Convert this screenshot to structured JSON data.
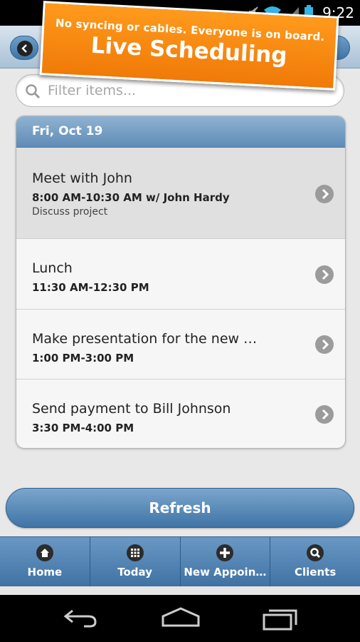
{
  "status_bar": {
    "time": "9:22"
  },
  "promo": {
    "tagline": "No syncing or cables. Everyone is on board.",
    "title": "Live Scheduling"
  },
  "filter": {
    "placeholder": "Filter items..."
  },
  "list": {
    "date_header": "Fri, Oct 19",
    "items": [
      {
        "title": "Meet with John",
        "time": "8:00 AM-10:30 AM w/ John Hardy",
        "note": "Discuss project"
      },
      {
        "title": "Lunch",
        "time": "11:30 AM-12:30 PM"
      },
      {
        "title": "Make presentation for the new …",
        "time": "1:00 PM-3:00 PM"
      },
      {
        "title": "Send payment to Bill Johnson",
        "time": "3:30 PM-4:00 PM"
      }
    ]
  },
  "refresh_label": "Refresh",
  "tabs": [
    {
      "label": "Home",
      "icon": "home-icon"
    },
    {
      "label": "Today",
      "icon": "grid-icon"
    },
    {
      "label": "New Appoin…",
      "icon": "plus-icon"
    },
    {
      "label": "Clients",
      "icon": "search-icon"
    }
  ],
  "colors": {
    "accent": "#4f82b2",
    "promo": "#f58a10",
    "header": "#5f8cb6"
  }
}
